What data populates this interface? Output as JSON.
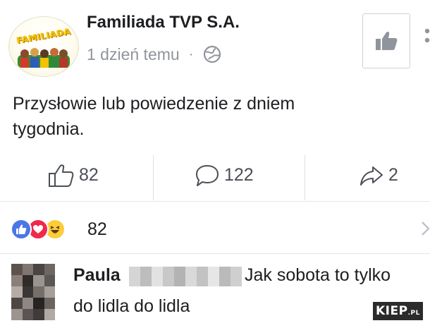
{
  "post": {
    "page_name": "Familiada TVP S.A.",
    "timestamp": "1 dzień temu",
    "separator": "·",
    "privacy_icon": "globe-icon",
    "logo_text": "FAMILIADA",
    "text_line1": "Przysłowie lub powiedzenie z dniem",
    "text_line2": "tygodnia."
  },
  "actions": {
    "likes": "82",
    "comments": "122",
    "shares": "2"
  },
  "reactions": {
    "icons": [
      "like-reaction-icon",
      "love-reaction-icon",
      "haha-reaction-icon"
    ],
    "count": "82"
  },
  "comment": {
    "author_first": "Paula",
    "text_line1": "Jak sobota to tylko",
    "text_line2": "do lidla do lidla"
  },
  "watermark": {
    "main": "KIEP",
    "suffix": ".PL"
  },
  "colors": {
    "like_blue": "#4a76e8",
    "love_red": "#f0284a",
    "haha_yellow": "#fbcd3b",
    "meta_gray": "#90949c"
  }
}
